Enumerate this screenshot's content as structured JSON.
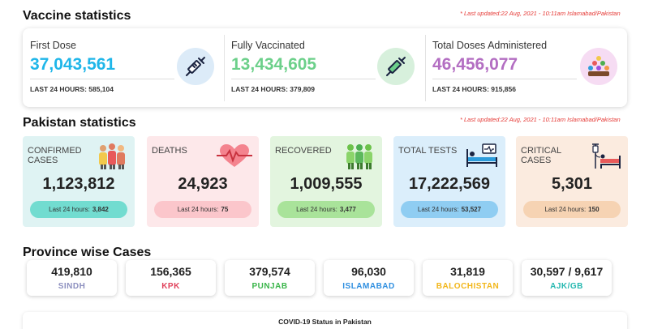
{
  "vaccine": {
    "title": "Vaccine statistics",
    "updated": "* Last updated:22 Aug, 2021 - 10:11am Islamabad/Pakistan",
    "columns": [
      {
        "label": "First Dose",
        "value": "37,043,561",
        "last24": "LAST 24 HOURS: 585,104",
        "color": "#1fb6e9",
        "icon": "syringe-icon"
      },
      {
        "label": "Fully Vaccinated",
        "value": "13,434,605",
        "last24": "LAST 24 HOURS: 379,809",
        "color": "#6cd08a",
        "icon": "syringe-icon"
      },
      {
        "label": "Total Doses Administered",
        "value": "46,456,077",
        "last24": "LAST 24 HOURS: 915,856",
        "color": "#b36ec2",
        "icon": "people-group-icon"
      }
    ]
  },
  "pakistan": {
    "title": "Pakistan statistics",
    "updated": "* Last updated:22 Aug, 2021 - 10:11am Islamabad/Pakistan",
    "cards": [
      {
        "label": "CONFIRMED CASES",
        "value": "1,123,812",
        "last24_label": "Last 24 hours:",
        "last24_value": "3,842",
        "bg": "#dff3f3",
        "pill": "#72dcd0",
        "icon": "family-icon"
      },
      {
        "label": "DEATHS",
        "value": "24,923",
        "last24_label": "Last 24 hours:",
        "last24_value": "75",
        "bg": "#fde8ea",
        "pill": "#fbc6cb",
        "icon": "heartbeat-icon"
      },
      {
        "label": "RECOVERED",
        "value": "1,009,555",
        "last24_label": "Last 24 hours:",
        "last24_value": "3,477",
        "bg": "#e3f5df",
        "pill": "#a9e39a",
        "icon": "people-icon"
      },
      {
        "label": "TOTAL TESTS",
        "value": "17,222,569",
        "last24_label": "Last 24 hours:",
        "last24_value": "53,527",
        "bg": "#dbeefb",
        "pill": "#8fcdf2",
        "icon": "hospital-bed-icon"
      },
      {
        "label": "CRITICAL CASES",
        "value": "5,301",
        "last24_label": "Last 24 hours:",
        "last24_value": "150",
        "bg": "#fbebdf",
        "pill": "#f6d3b3",
        "icon": "iv-bed-icon"
      }
    ]
  },
  "province": {
    "title": "Province wise Cases",
    "items": [
      {
        "value": "419,810",
        "name": "SINDH",
        "color": "#8c8fbf"
      },
      {
        "value": "156,365",
        "name": "KPK",
        "color": "#e0405a"
      },
      {
        "value": "379,574",
        "name": "PUNJAB",
        "color": "#3ab54a"
      },
      {
        "value": "96,030",
        "name": "ISLAMABAD",
        "color": "#2f8fe0"
      },
      {
        "value": "31,819",
        "name": "BALOCHISTAN",
        "color": "#f2b619"
      },
      {
        "value": "30,597 / 9,617",
        "name": "AJK/GB",
        "color": "#25b8b0"
      }
    ]
  },
  "footer": {
    "title": "COVID-19 Status in Pakistan"
  }
}
